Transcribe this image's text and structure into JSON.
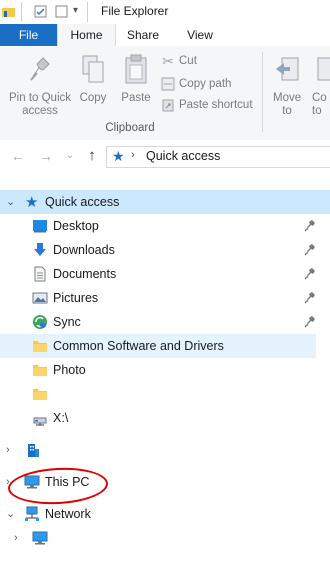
{
  "window": {
    "title": "File Explorer"
  },
  "tabs": [
    {
      "id": "file",
      "label": "File"
    },
    {
      "id": "home",
      "label": "Home"
    },
    {
      "id": "share",
      "label": "Share"
    },
    {
      "id": "view",
      "label": "View"
    }
  ],
  "ribbon": {
    "pin_label": "Pin to Quick access",
    "copy_label": "Copy",
    "paste_label": "Paste",
    "cut_label": "Cut",
    "copy_path_label": "Copy path",
    "paste_shortcut_label": "Paste shortcut",
    "clipboard_group": "Clipboard",
    "move_to_label": "Move to",
    "copy_to_label": "Co to"
  },
  "address": {
    "path": "Quick access"
  },
  "nav": {
    "quick_access": "Quick access",
    "items": [
      {
        "label": "Desktop",
        "icon": "desktop-icon",
        "pinned": true
      },
      {
        "label": "Downloads",
        "icon": "download-icon",
        "pinned": true
      },
      {
        "label": "Documents",
        "icon": "documents-icon",
        "pinned": true
      },
      {
        "label": "Pictures",
        "icon": "pictures-icon",
        "pinned": true
      },
      {
        "label": "Sync",
        "icon": "sync-icon",
        "pinned": true
      },
      {
        "label": "Common Software and Drivers",
        "icon": "folder-icon",
        "pinned": false
      },
      {
        "label": "Photo",
        "icon": "folder-icon",
        "pinned": false
      },
      {
        "label": "",
        "icon": "folder-icon",
        "pinned": false
      },
      {
        "label": "X:\\",
        "icon": "network-drive-icon",
        "pinned": false
      }
    ],
    "onedrive_label": "",
    "this_pc": "This PC",
    "network": "Network",
    "network_child_label": ""
  },
  "colors": {
    "file_tab": "#1a6fc4",
    "selected": "#cce8ff",
    "hover": "#e5f3ff",
    "annotation": "#e00000"
  }
}
